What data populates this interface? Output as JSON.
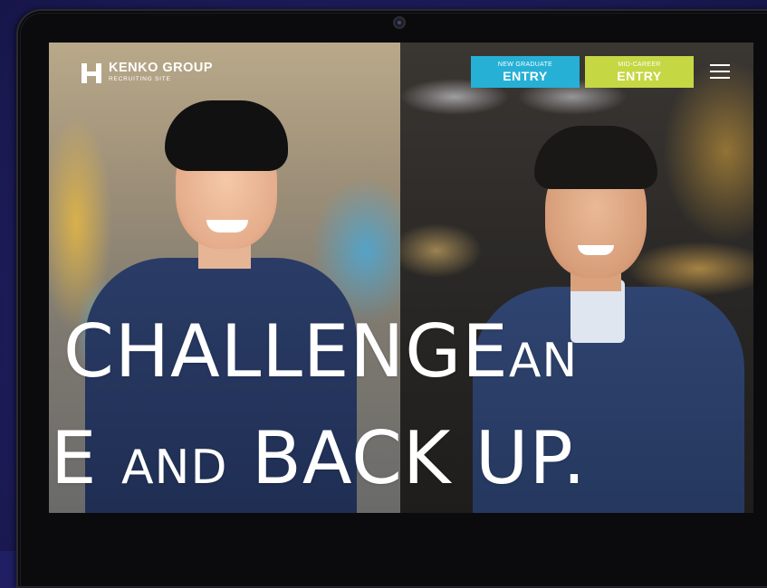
{
  "brand": {
    "title": "KENKO GROUP",
    "subtitle": "RECRUITING SITE"
  },
  "nav": {
    "new_graduate": {
      "small": "NEW GRADUATE",
      "big": "ENTRY",
      "color": "#26b0d6"
    },
    "mid_career": {
      "small": "MID-CAREER",
      "big": "ENTRY",
      "color": "#c6d744"
    },
    "menu_icon": "hamburger-menu-icon"
  },
  "hero": {
    "line1_main": "CHALLENGE",
    "line1_small": "AN",
    "line2_start": "E",
    "line2_small": "AND",
    "line2_main": "BACK UP."
  },
  "colors": {
    "background": "#201f63",
    "text": "#ffffff"
  }
}
